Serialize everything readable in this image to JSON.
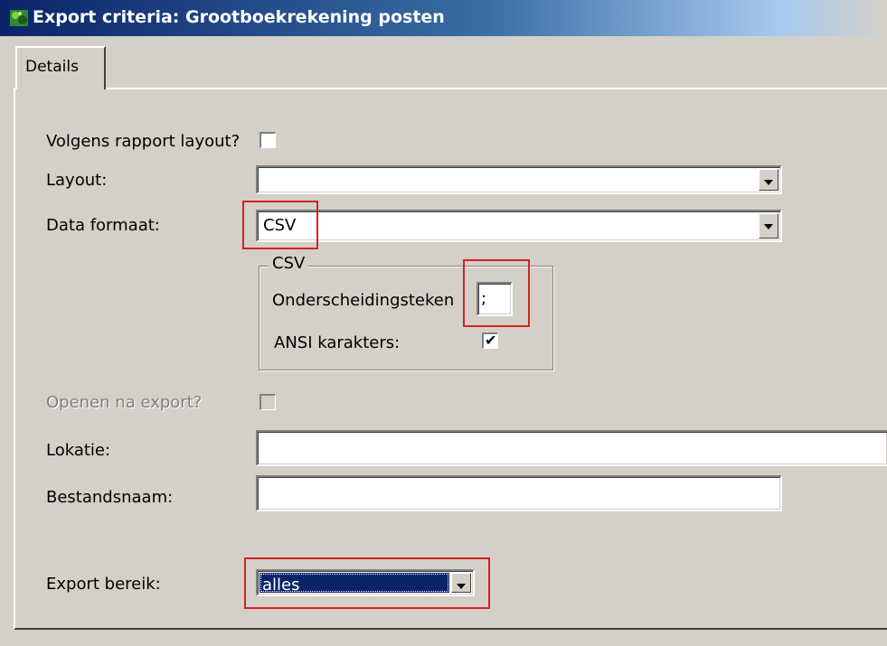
{
  "window": {
    "title": "Export criteria: Grootboekrekening posten",
    "icon": "app-icon"
  },
  "tabs": [
    {
      "label": "Details",
      "active": true
    }
  ],
  "form": {
    "volgens_label": "Volgens rapport layout?",
    "volgens_checked": false,
    "layout_label": "Layout:",
    "layout_value": "",
    "data_formaat_label": "Data formaat:",
    "data_formaat_value": "CSV",
    "csv_group": {
      "title": "CSV",
      "separator_label": "Onderscheidingsteken",
      "separator_value": ";",
      "ansi_label": "ANSI karakters:",
      "ansi_checked": true
    },
    "openen_label": "Openen na export?",
    "openen_checked": false,
    "lokatie_label": "Lokatie:",
    "lokatie_value": "",
    "bestandsnaam_label": "Bestandsnaam:",
    "bestandsnaam_value": "",
    "export_bereik_label": "Export bereik:",
    "export_bereik_value": "alles"
  },
  "colors": {
    "title_bar": "#0a246a",
    "highlight_box": "#d22222",
    "face": "#d4d0c8"
  }
}
